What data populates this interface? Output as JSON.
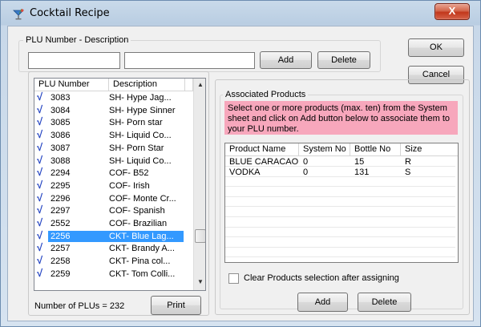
{
  "window": {
    "title": "Cocktail Recipe",
    "close_glyph": "X"
  },
  "plu_group": {
    "label": "PLU Number - Description",
    "plu_input": {
      "value": "",
      "placeholder": ""
    },
    "desc_input": {
      "value": "",
      "placeholder": ""
    },
    "add_label": "Add",
    "delete_label": "Delete"
  },
  "buttons": {
    "ok_label": "OK",
    "cancel_label": "Cancel"
  },
  "plu_list": {
    "headers": [
      "PLU Number",
      "Description"
    ],
    "check_glyph": "√",
    "rows": [
      {
        "number": "3083",
        "description": "SH- Hype Jag..."
      },
      {
        "number": "3084",
        "description": "SH- Hype Sinner"
      },
      {
        "number": "3085",
        "description": "SH- Porn star"
      },
      {
        "number": "3086",
        "description": "SH- Liquid Co..."
      },
      {
        "number": "3087",
        "description": "SH- Porn Star"
      },
      {
        "number": "3088",
        "description": "SH- Liquid Co..."
      },
      {
        "number": "2294",
        "description": "COF- B52"
      },
      {
        "number": "2295",
        "description": "COF- Irish"
      },
      {
        "number": "2296",
        "description": "COF- Monte Cr..."
      },
      {
        "number": "2297",
        "description": "COF- Spanish"
      },
      {
        "number": "2552",
        "description": "COF- Brazilian"
      },
      {
        "number": "2256",
        "description": "CKT- Blue Lag..."
      },
      {
        "number": "2257",
        "description": "CKT- Brandy A..."
      },
      {
        "number": "2258",
        "description": "CKT- Pina col..."
      },
      {
        "number": "2259",
        "description": "CKT- Tom Colli..."
      }
    ],
    "selected_index": 11,
    "count_label": "Number of PLUs =",
    "count_value": "232",
    "print_label": "Print"
  },
  "associated": {
    "label": "Associated Products",
    "info_text": "Select one or more products (max. ten) from the System sheet and click on Add button below to associate them to your PLU number.",
    "headers": [
      "Product Name",
      "System No",
      "Bottle No",
      "Size"
    ],
    "rows": [
      {
        "name": "BLUE CARACAO",
        "system_no": "0",
        "bottle_no": "15",
        "size": "R"
      },
      {
        "name": "VODKA",
        "system_no": "0",
        "bottle_no": "131",
        "size": "S"
      }
    ],
    "clear_label": "Clear Products selection after assigning",
    "clear_checked": false,
    "add_label": "Add",
    "delete_label": "Delete"
  },
  "colors": {
    "info_background": "#f7a7bc",
    "selection": "#3399ff",
    "check_mark": "#1e3fc0"
  }
}
